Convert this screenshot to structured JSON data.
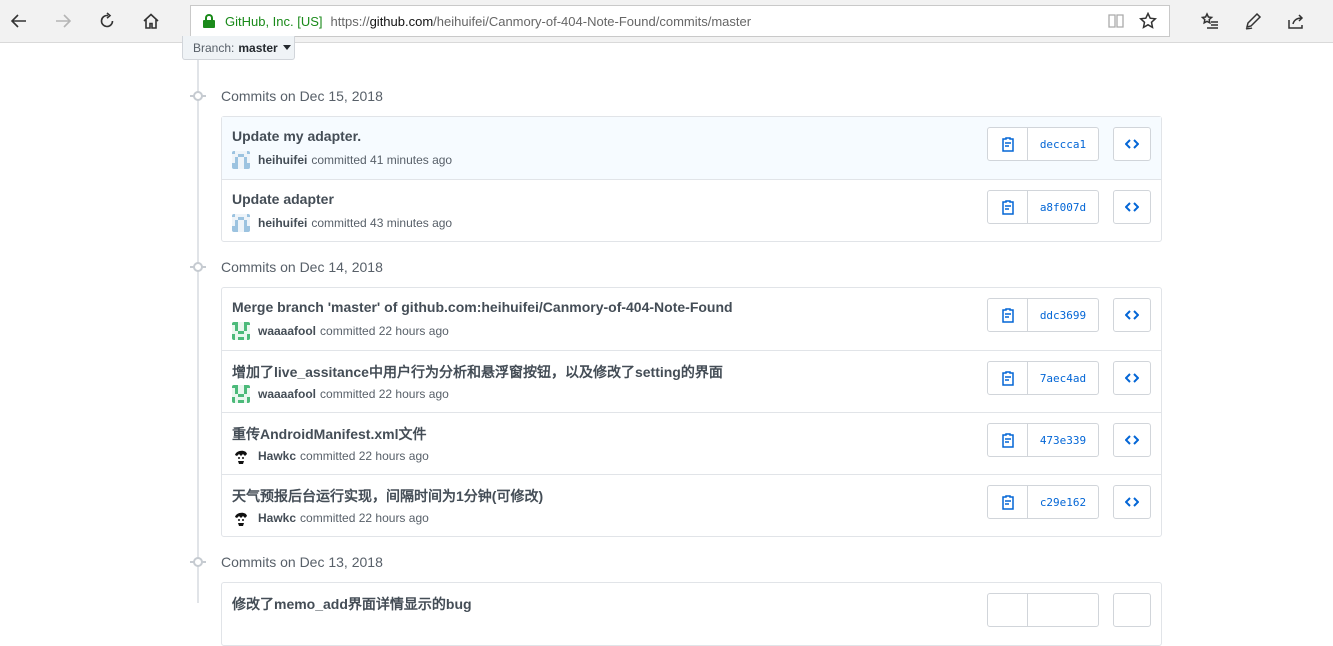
{
  "browser": {
    "site_identity": "GitHub, Inc. [US]",
    "url_prefix": "https://",
    "url_host": "github.com",
    "url_path": "/heihuifei/Canmory-of-404-Note-Found/commits/master"
  },
  "branch": {
    "label": "Branch:",
    "name": "master"
  },
  "groups": [
    {
      "title": "Commits on Dec 15, 2018",
      "commits": [
        {
          "message": "Update my adapter.",
          "author": "heihuifei",
          "verb": "committed",
          "time": "41 minutes ago",
          "sha": "deccca1"
        },
        {
          "message": "Update adapter",
          "author": "heihuifei",
          "verb": "committed",
          "time": "43 minutes ago",
          "sha": "a8f007d"
        }
      ]
    },
    {
      "title": "Commits on Dec 14, 2018",
      "commits": [
        {
          "message": "Merge branch 'master' of github.com:heihuifei/Canmory-of-404-Note-Found",
          "author": "waaaafool",
          "verb": "committed",
          "time": "22 hours ago",
          "sha": "ddc3699"
        },
        {
          "message": "增加了live_assitance中用户行为分析和悬浮窗按钮，以及修改了setting的界面",
          "author": "waaaafool",
          "verb": "committed",
          "time": "22 hours ago",
          "sha": "7aec4ad"
        },
        {
          "message": "重传AndroidManifest.xml文件",
          "author": "Hawkc",
          "verb": "committed",
          "time": "22 hours ago",
          "sha": "473e339"
        },
        {
          "message": "天气预报后台运行实现，间隔时间为1分钟(可修改)",
          "author": "Hawkc",
          "verb": "committed",
          "time": "22 hours ago",
          "sha": "c29e162"
        }
      ]
    },
    {
      "title": "Commits on Dec 13, 2018",
      "commits": [
        {
          "message": "修改了memo_add界面详情显示的bug",
          "author": "",
          "verb": "",
          "time": "",
          "sha": ""
        }
      ]
    }
  ],
  "colors": {
    "accent": "#0366d6",
    "secure": "#1a8a1a",
    "highlight_row": "#f6fbff"
  }
}
